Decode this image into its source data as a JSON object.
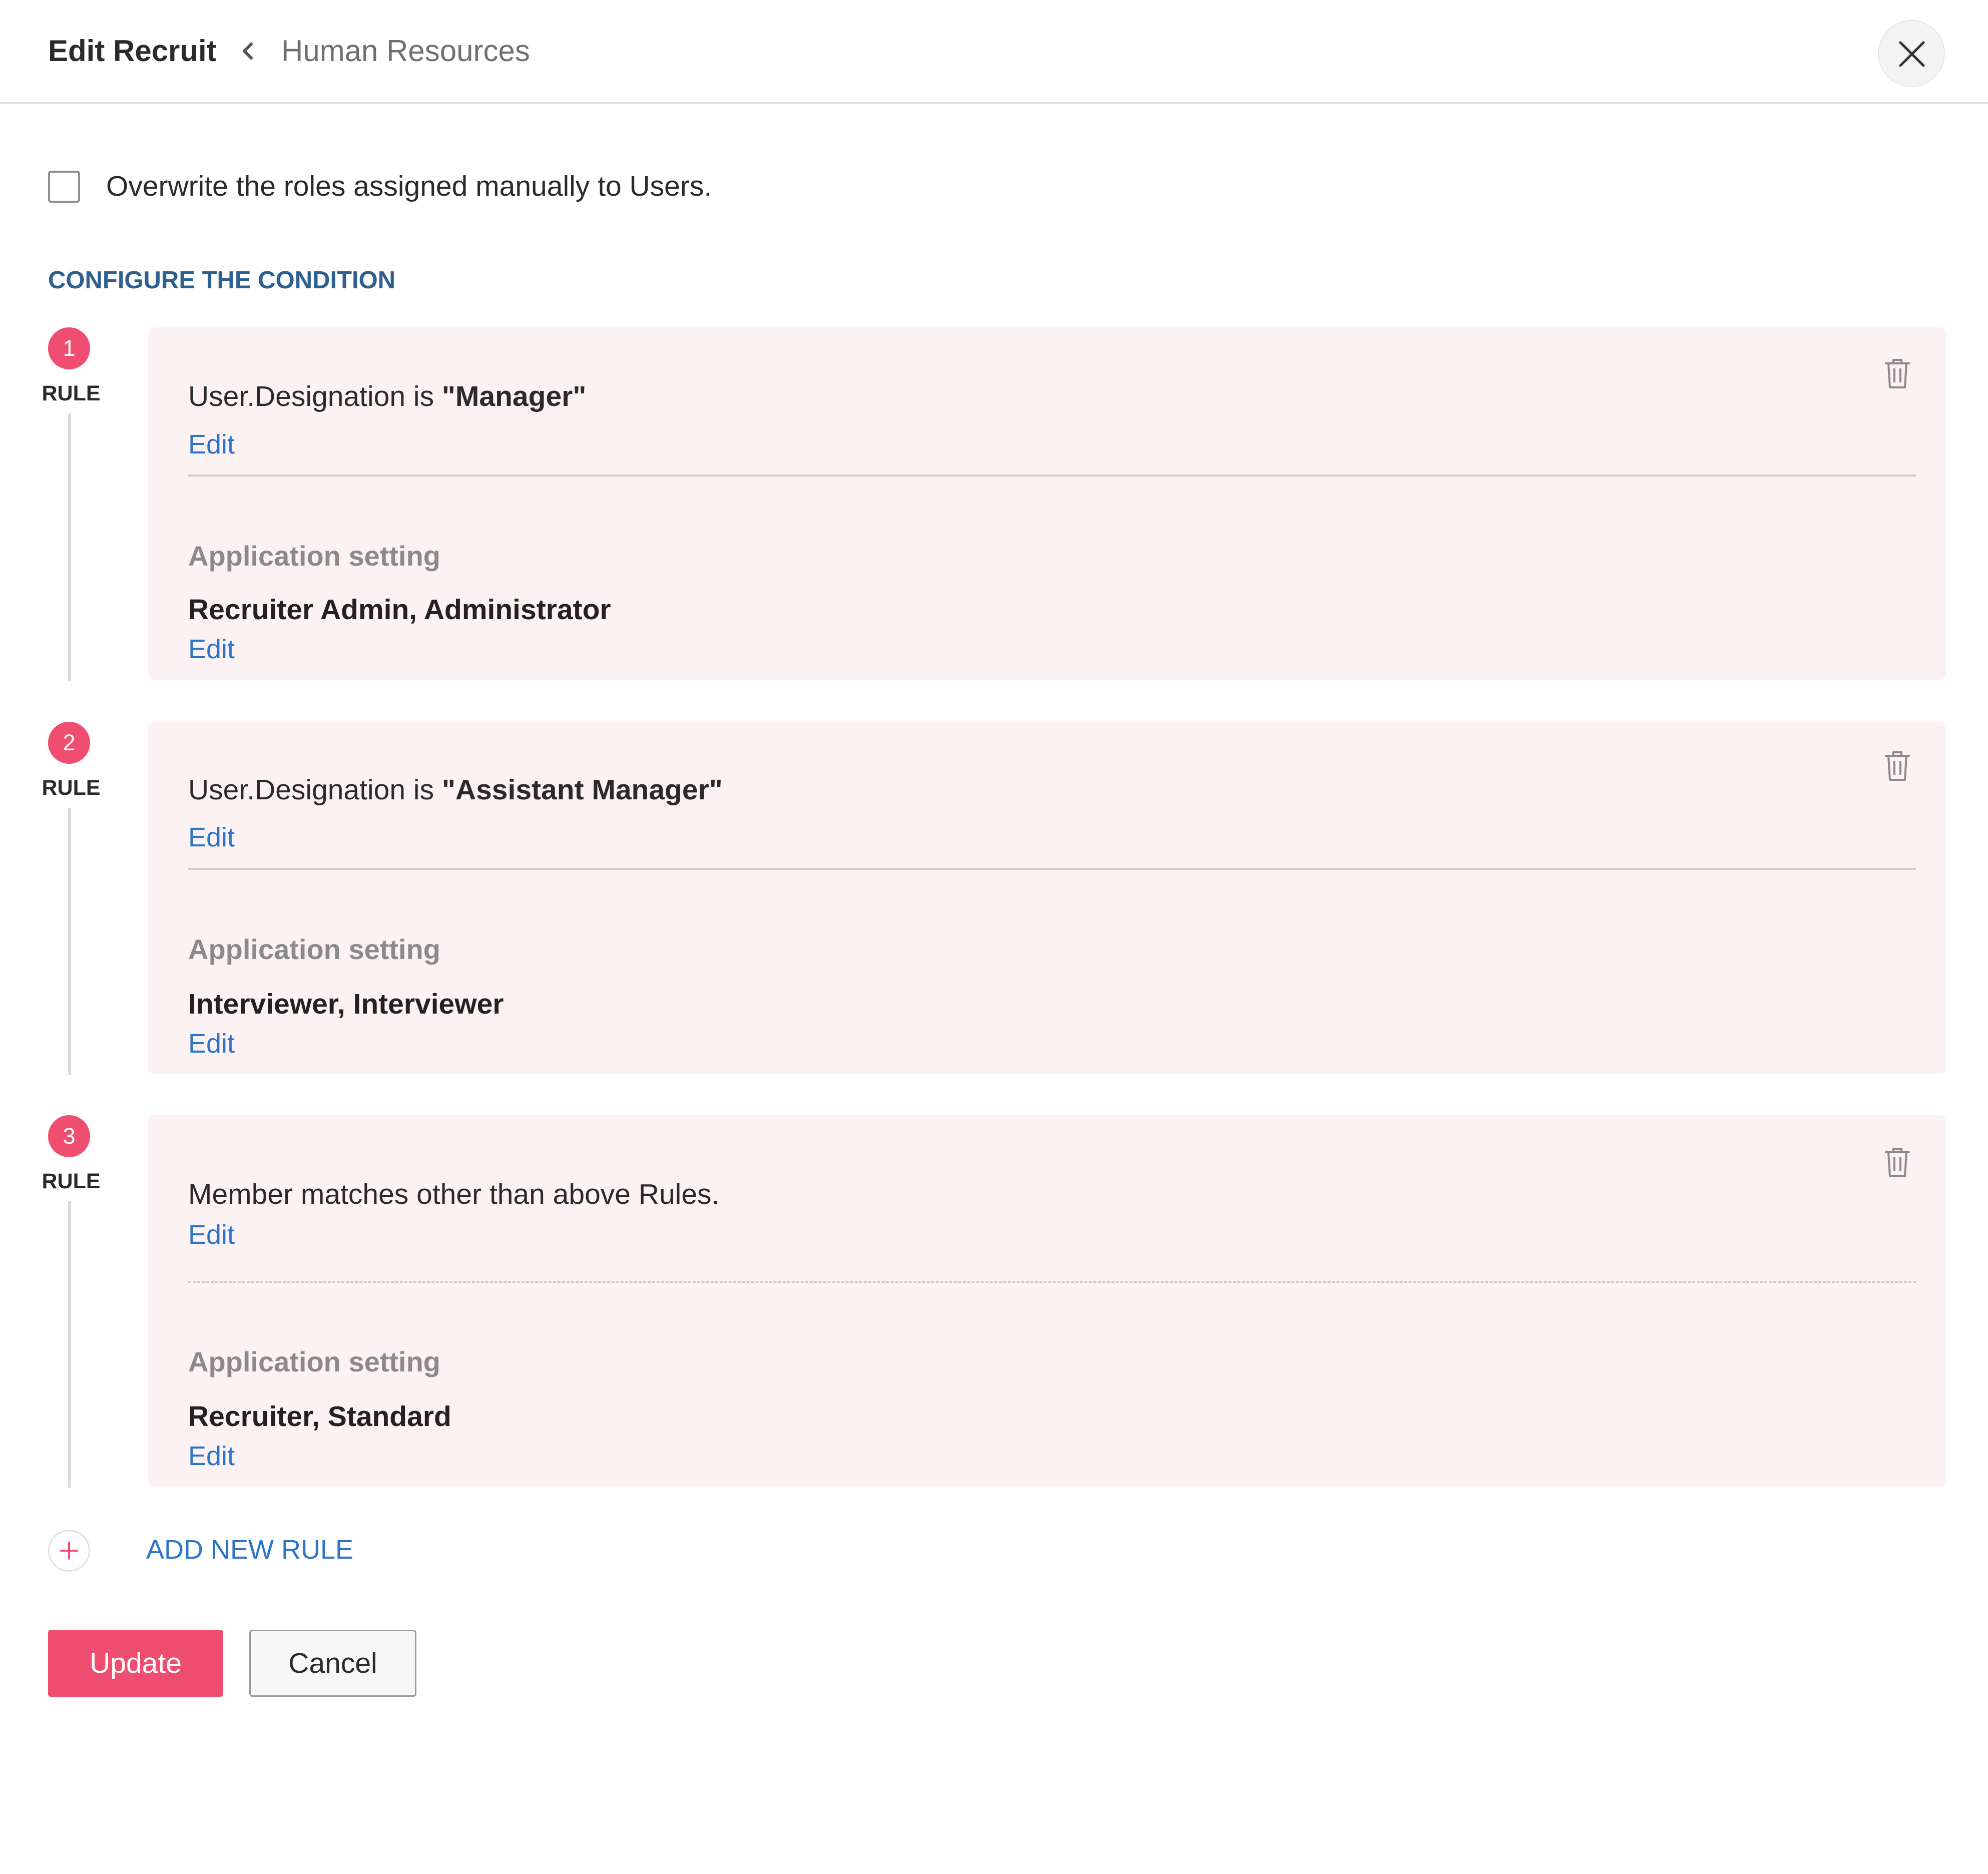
{
  "header": {
    "title": "Edit Recruit",
    "breadcrumb": "Human Resources"
  },
  "overwrite": {
    "label": "Overwrite the roles assigned manually to Users.",
    "checked": false
  },
  "section_heading": "CONFIGURE THE CONDITION",
  "rule_word": "RULE",
  "rules": [
    {
      "number": "1",
      "condition_prefix": "User.Designation is ",
      "condition_value": "\"Manager\"",
      "condition_text": "",
      "edit_label": "Edit",
      "setting_label": "Application setting",
      "setting_value": "Recruiter Admin, Administrator",
      "setting_edit_label": "Edit"
    },
    {
      "number": "2",
      "condition_prefix": "User.Designation is ",
      "condition_value": "\"Assistant Manager\"",
      "condition_text": "",
      "edit_label": "Edit",
      "setting_label": "Application setting",
      "setting_value": "Interviewer, Interviewer",
      "setting_edit_label": "Edit"
    },
    {
      "number": "3",
      "condition_prefix": "",
      "condition_value": "",
      "condition_text": "Member matches other than above Rules.",
      "edit_label": "Edit",
      "setting_label": "Application setting",
      "setting_value": "Recruiter, Standard",
      "setting_edit_label": "Edit"
    }
  ],
  "add_rule_label": "ADD NEW RULE",
  "buttons": {
    "update": "Update",
    "cancel": "Cancel"
  },
  "colors": {
    "accent": "#ef4e70",
    "link": "#2c74c8",
    "heading": "#2f5f8f",
    "card_background": "#fdf2f3"
  },
  "icons": {
    "close": "close-icon",
    "back": "chevron-left-icon",
    "delete": "trash-icon",
    "add": "plus-icon"
  }
}
